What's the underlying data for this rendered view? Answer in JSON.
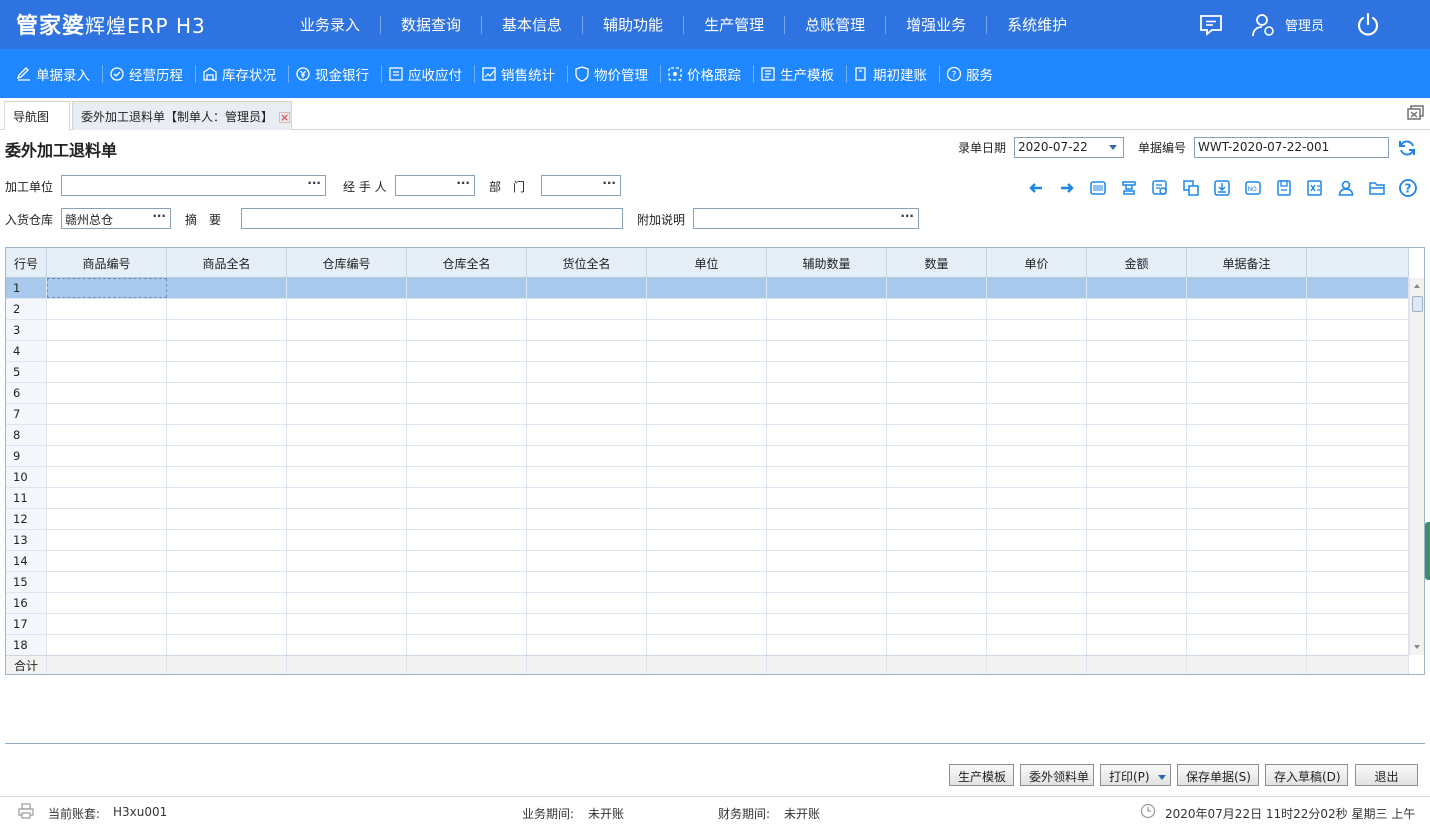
{
  "app": {
    "logo": "管家婆",
    "product": "辉煌ERP H3",
    "main_nav": [
      "业务录入",
      "数据查询",
      "基本信息",
      "辅助功能",
      "生产管理",
      "总账管理",
      "增强业务",
      "系统维护"
    ],
    "user": "管理员"
  },
  "toolbar": {
    "items": [
      {
        "label": "单据录入",
        "icon": "edit-icon"
      },
      {
        "label": "经营历程",
        "icon": "check-circle-icon"
      },
      {
        "label": "库存状况",
        "icon": "warehouse-icon"
      },
      {
        "label": "现金银行",
        "icon": "yen-coin-icon"
      },
      {
        "label": "应收应付",
        "icon": "ledger-icon"
      },
      {
        "label": "销售统计",
        "icon": "sales-chart-icon"
      },
      {
        "label": "物价管理",
        "icon": "shield-price-icon"
      },
      {
        "label": "价格跟踪",
        "icon": "price-track-icon"
      },
      {
        "label": "生产模板",
        "icon": "template-icon"
      },
      {
        "label": "期初建账",
        "icon": "book-icon"
      },
      {
        "label": "服务",
        "icon": "help-circle-icon"
      }
    ]
  },
  "tabs": [
    {
      "label": "导航图"
    },
    {
      "label": "委外加工退料单【制单人：管理员】"
    }
  ],
  "form": {
    "title": "委外加工退料单",
    "date_label": "录单日期",
    "date_value": "2020-07-22",
    "number_label": "单据编号",
    "number_value": "WWT-2020-07-22-001",
    "processor_label": "加工单位",
    "processor_value": "",
    "handler_label": "经 手 人",
    "handler_value": "",
    "dept_label": "部　门",
    "dept_value": "",
    "warehouse_label": "入货仓库",
    "warehouse_value": "赣州总仓",
    "summary_label": "摘　要",
    "summary_value": "",
    "note_label": "附加说明",
    "note_value": "",
    "lookup_glyph": "···"
  },
  "action_icons": [
    "arrow-left-icon",
    "arrow-right-icon",
    "barcode-icon",
    "stamp-icon",
    "settings-doc-icon",
    "copy-icon",
    "import-icon",
    "number-icon",
    "save-disk-icon",
    "excel-icon",
    "user-icon",
    "folder-icon",
    "help-icon"
  ],
  "grid": {
    "columns": [
      "行号",
      "商品编号",
      "商品全名",
      "仓库编号",
      "仓库全名",
      "货位全名",
      "单位",
      "辅助数量",
      "数量",
      "单价",
      "金额",
      "单据备注"
    ],
    "rows": [
      "1",
      "2",
      "3",
      "4",
      "5",
      "6",
      "7",
      "8",
      "9",
      "10",
      "11",
      "12",
      "13",
      "14",
      "15",
      "16",
      "17",
      "18"
    ],
    "selected_row": 1,
    "footer_label": "合计"
  },
  "buttons": {
    "template": "生产模板",
    "pick": "委外领料单",
    "print": "打印(P)",
    "save": "保存单据(S)",
    "draft": "存入草稿(D)",
    "exit": "退出"
  },
  "status": {
    "account_label": "当前账套:",
    "account_value": "H3xu001",
    "biz_period_label": "业务期间:",
    "biz_period_value": "未开账",
    "fin_period_label": "财务期间:",
    "fin_period_value": "未开账",
    "datetime": "2020年07月22日 11时22分02秒 星期三 上午"
  }
}
